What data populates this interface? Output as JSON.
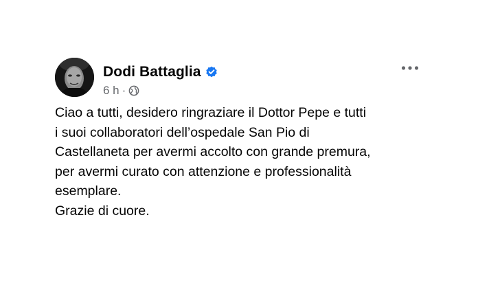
{
  "post": {
    "author": "Dodi Battaglia",
    "timestamp": "6 h",
    "separator": "·",
    "verified_icon": "verified-badge-icon",
    "audience_icon": "globe-icon",
    "more_icon": "more-options-icon",
    "accent_color": "#1877f2",
    "secondary_text_color": "#65676b",
    "lines": [
      "Ciao a tutti, desidero ringraziare il Dottor Pepe e tutti",
      "i suoi collaboratori dell’ospedale San Pio di",
      "Castellaneta per avermi accolto con grande premura,",
      "per avermi curato con attenzione e professionalità",
      "esemplare.",
      "Grazie di cuore."
    ]
  }
}
